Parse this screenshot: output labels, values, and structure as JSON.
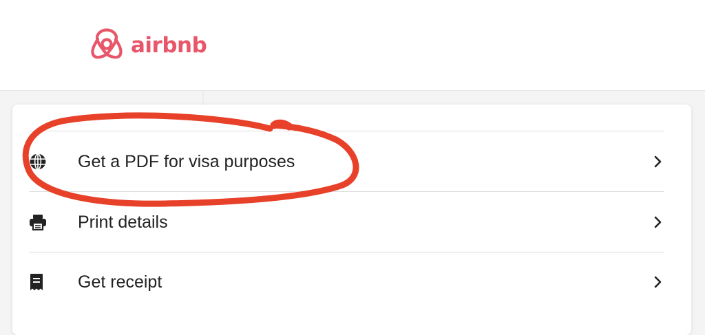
{
  "header": {
    "logo_text": "airbnb",
    "brand_color": "#e8566a"
  },
  "menu": {
    "items": [
      {
        "label": "Get a PDF for visa purposes",
        "icon": "globe-icon"
      },
      {
        "label": "Print details",
        "icon": "printer-icon"
      },
      {
        "label": "Get receipt",
        "icon": "receipt-icon"
      }
    ]
  },
  "annotation": {
    "type": "hand-drawn circle",
    "color": "#e8412a",
    "encircles": "Get a PDF for visa purposes"
  }
}
